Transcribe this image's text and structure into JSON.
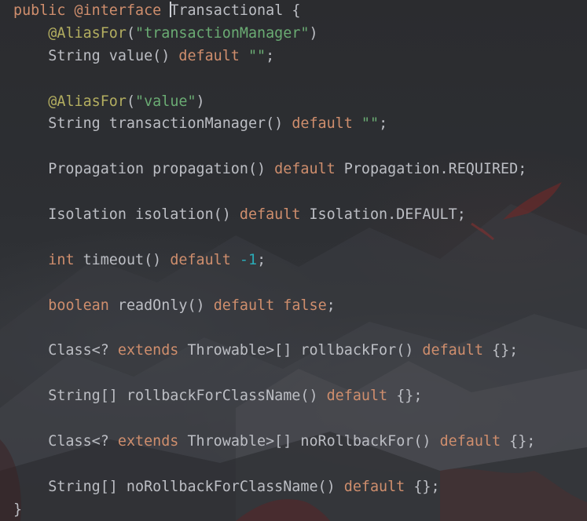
{
  "editor": {
    "lines": [
      [
        {
          "t": "public",
          "c": "kw"
        },
        {
          "t": " "
        },
        {
          "t": "@interface",
          "c": "kw"
        },
        {
          "t": " "
        },
        {
          "caret": true
        },
        {
          "t": "Transactional {"
        }
      ],
      [
        {
          "t": "    "
        },
        {
          "t": "@AliasFor",
          "c": "ann"
        },
        {
          "t": "("
        },
        {
          "t": "\"transactionManager\"",
          "c": "str"
        },
        {
          "t": ")"
        }
      ],
      [
        {
          "t": "    String value() "
        },
        {
          "t": "default",
          "c": "kw"
        },
        {
          "t": " "
        },
        {
          "t": "\"\"",
          "c": "str"
        },
        {
          "t": ";"
        }
      ],
      [],
      [
        {
          "t": "    "
        },
        {
          "t": "@AliasFor",
          "c": "ann"
        },
        {
          "t": "("
        },
        {
          "t": "\"value\"",
          "c": "str"
        },
        {
          "t": ")"
        }
      ],
      [
        {
          "t": "    String transactionManager() "
        },
        {
          "t": "default",
          "c": "kw"
        },
        {
          "t": " "
        },
        {
          "t": "\"\"",
          "c": "str"
        },
        {
          "t": ";"
        }
      ],
      [],
      [
        {
          "t": "    Propagation propagation() "
        },
        {
          "t": "default",
          "c": "kw"
        },
        {
          "t": " Propagation.REQUIRED;"
        }
      ],
      [],
      [
        {
          "t": "    Isolation isolation() "
        },
        {
          "t": "default",
          "c": "kw"
        },
        {
          "t": " Isolation.DEFAULT;"
        }
      ],
      [],
      [
        {
          "t": "    "
        },
        {
          "t": "int",
          "c": "kw"
        },
        {
          "t": " timeout() "
        },
        {
          "t": "default",
          "c": "kw"
        },
        {
          "t": " "
        },
        {
          "t": "-1",
          "c": "num"
        },
        {
          "t": ";"
        }
      ],
      [],
      [
        {
          "t": "    "
        },
        {
          "t": "boolean",
          "c": "kw"
        },
        {
          "t": " readOnly() "
        },
        {
          "t": "default",
          "c": "kw"
        },
        {
          "t": " "
        },
        {
          "t": "false",
          "c": "kw"
        },
        {
          "t": ";"
        }
      ],
      [],
      [
        {
          "t": "    Class<? "
        },
        {
          "t": "extends",
          "c": "kw"
        },
        {
          "t": " Throwable>[] rollbackFor() "
        },
        {
          "t": "default",
          "c": "kw"
        },
        {
          "t": " {};"
        }
      ],
      [],
      [
        {
          "t": "    String[] rollbackForClassName() "
        },
        {
          "t": "default",
          "c": "kw"
        },
        {
          "t": " {};"
        }
      ],
      [],
      [
        {
          "t": "    Class<? "
        },
        {
          "t": "extends",
          "c": "kw"
        },
        {
          "t": " Throwable>[] noRollbackFor() "
        },
        {
          "t": "default",
          "c": "kw"
        },
        {
          "t": " {};"
        }
      ],
      [],
      [
        {
          "t": "    String[] noRollbackForClassName() "
        },
        {
          "t": "default",
          "c": "kw"
        },
        {
          "t": " {};"
        }
      ],
      [
        {
          "t": "}"
        }
      ]
    ]
  },
  "colors": {
    "keyword": "#cf8e6d",
    "annotation": "#b3ae60",
    "string": "#6aab73",
    "number": "#2aacb8",
    "text": "#bcbec4"
  }
}
